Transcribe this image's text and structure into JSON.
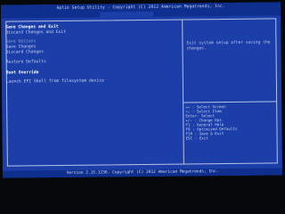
{
  "title": "Aptio Setup Utility - Copyright (C) 2012 American Megatrends, Inc.",
  "footer": "Version 2.15.1236. Copyright (C) 2012 American Megatrends, Inc.",
  "menu": {
    "section_save_exit": "Save Changes and Exit",
    "item_discard_exit": "Discard Changes and Exit",
    "item_save_edits": "Save Options",
    "item_save_changes": "Save Changes",
    "item_discard_changes": "Discard Changes",
    "item_restore_defaults": "Restore Defaults",
    "section_boot_override": "Boot Override",
    "item_launch_efi_shell": "Launch EFI Shell from filesystem device"
  },
  "help_text": "Exit system setup after saving the changes.",
  "keys": [
    "→← : Select Screen",
    "↑↓ : Select Item",
    "Enter: Select",
    "+/- : Change Opt.",
    "F1  : General Help",
    "F9  : Optimized Defaults",
    "F10 : Save & Exit",
    "ESC : Exit"
  ]
}
